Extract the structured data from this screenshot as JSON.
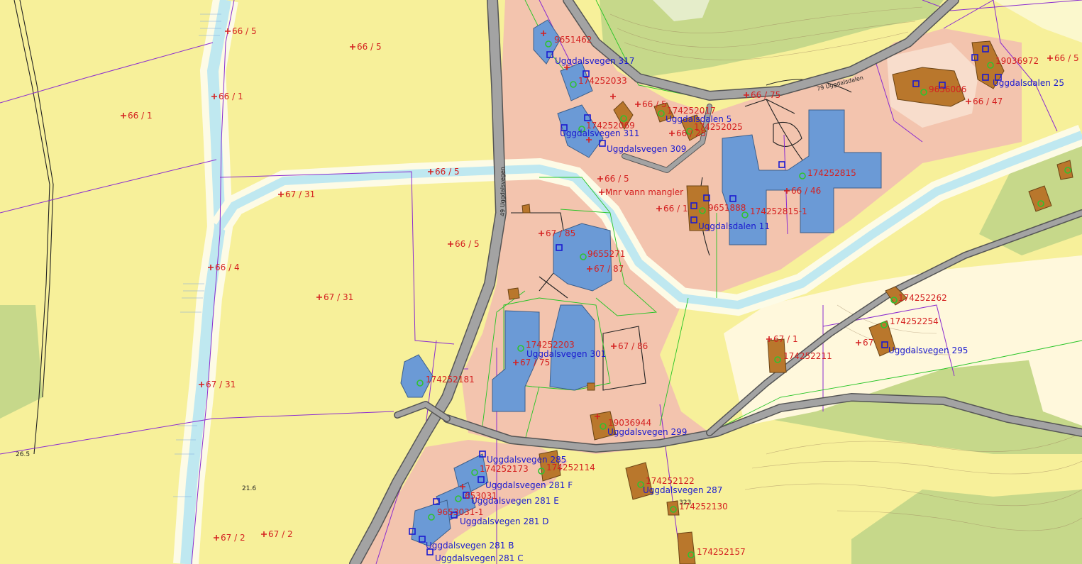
{
  "map": {
    "colors": {
      "agriculture": "#f7f09a",
      "forest": "#c6d88a",
      "built_up": "#f3c4ae",
      "river": "#bfe8f0",
      "road": "#a3a3a3",
      "residential_building": "#6b9ad6",
      "other_building": "#b9772c",
      "parcel_label": "#d42020",
      "address_label": "#1a1ad0",
      "parcel_boundary": "#8a2bd0",
      "building_outline": "#24c424"
    },
    "road_labels": [
      {
        "text": "79 Uggdalsdalen"
      },
      {
        "text": "49 Uggdalsvegen"
      }
    ],
    "parcel_labels": [
      "66 / 5",
      "66 / 5",
      "66 / 1",
      "66 / 1",
      "66 / 5",
      "67 / 31",
      "66 / 5",
      "66 / 4",
      "67 / 31",
      "67 / 31",
      "67 / 2",
      "67 / 2",
      "66 / 75",
      "66 / 47",
      "66 / 5",
      "66 / 5",
      "Mnr vann mangler",
      "66 / 1",
      "66 / 46",
      "67 / 85",
      "67 / 87",
      "67 / 86",
      "67 / 75",
      "66 / 25",
      "66 / 5",
      "67 / 1",
      "67"
    ],
    "building_ids": [
      "9651462",
      "174252033",
      "174252069",
      "174252017",
      "174252025",
      "174252815",
      "9651888",
      "174252815-1",
      "19036972",
      "9656006",
      "9655271",
      "174252203",
      "174252181",
      "19036944",
      "174252173",
      "174252114",
      "653031",
      "9653031-1",
      "174252262",
      "174252254",
      "174252211",
      "174252122",
      "174252130",
      "174252157"
    ],
    "addresses": [
      "Uggdalsvegen 317",
      "Uggdalsvegen 311",
      "Uggdalsvegen 309",
      "Uggdalsdalen 5",
      "Uggdalsdalen 11",
      "Uggdalsdalen 25",
      "Uggdalsvegen 301",
      "Uggdalsvegen 299",
      "Uggdalsvegen 285",
      "Uggdalsvegen 281 F",
      "Uggdalsvegen 281 E",
      "Uggdalsvegen 281 D",
      "Uggdalsvegen 281 B",
      "Uggdalsvegen 281 C",
      "Uggdalsvegen 287",
      "Uggdalsvegen 295"
    ],
    "spot_heights": [
      "26.5",
      "21.6",
      "323"
    ]
  }
}
